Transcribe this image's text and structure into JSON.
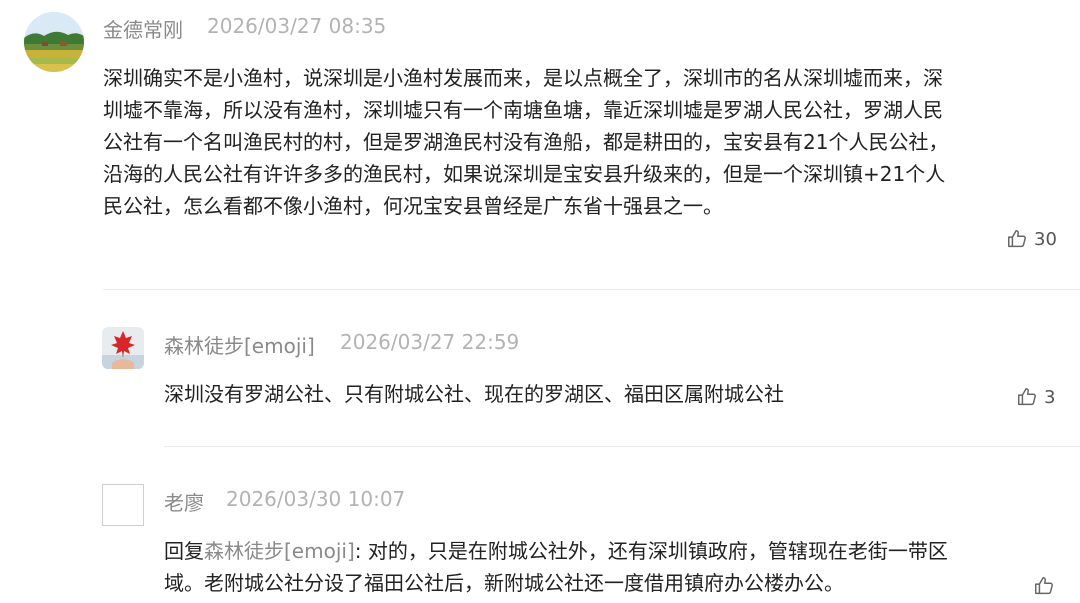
{
  "comments": [
    {
      "user": "金德常刚",
      "time": "2026/03/27 08:35",
      "text": "深圳确实不是小渔村，说深圳是小渔村发展而来，是以点概全了，深圳市的名从深圳墟而来，深圳墟不靠海，所以没有渔村，深圳墟只有一个南塘鱼塘，靠近深圳墟是罗湖人民公社，罗湖人民公社有一个名叫渔民村的村，但是罗湖渔民村没有渔船，都是耕田的，宝安县有21个人民公社，沿海的人民公社有许许多多的渔民村，如果说深圳是宝安县升级来的，但是一个深圳镇+21个人民公社，怎么看都不像小渔村，何况宝安县曾经是广东省十强县之一。",
      "likes": "30",
      "avatar_icon": "landscape-avatar-icon"
    },
    {
      "user": "森林徒步[emoji]",
      "time": "2026/03/27 22:59",
      "text": "深圳没有罗湖公社、只有附城公社、现在的罗湖区、福田区属附城公社",
      "likes": "3",
      "avatar_icon": "maple-leaf-avatar-icon"
    },
    {
      "user": "老廖",
      "time": "2026/03/30 10:07",
      "reply_prefix": "回复",
      "reply_to": "森林徒步[emoji]",
      "text": ": 对的，只是在附城公社外，还有深圳镇政府，管辖现在老街一带区域。老附城公社分设了福田公社后，新附城公社还一度借用镇府办公楼办公。",
      "likes": "",
      "avatar_icon": "blank-avatar-icon"
    }
  ],
  "colors": {
    "name": "#8a8a8a",
    "time": "#b3b3b3",
    "text": "#222222",
    "divider": "#ececec"
  }
}
